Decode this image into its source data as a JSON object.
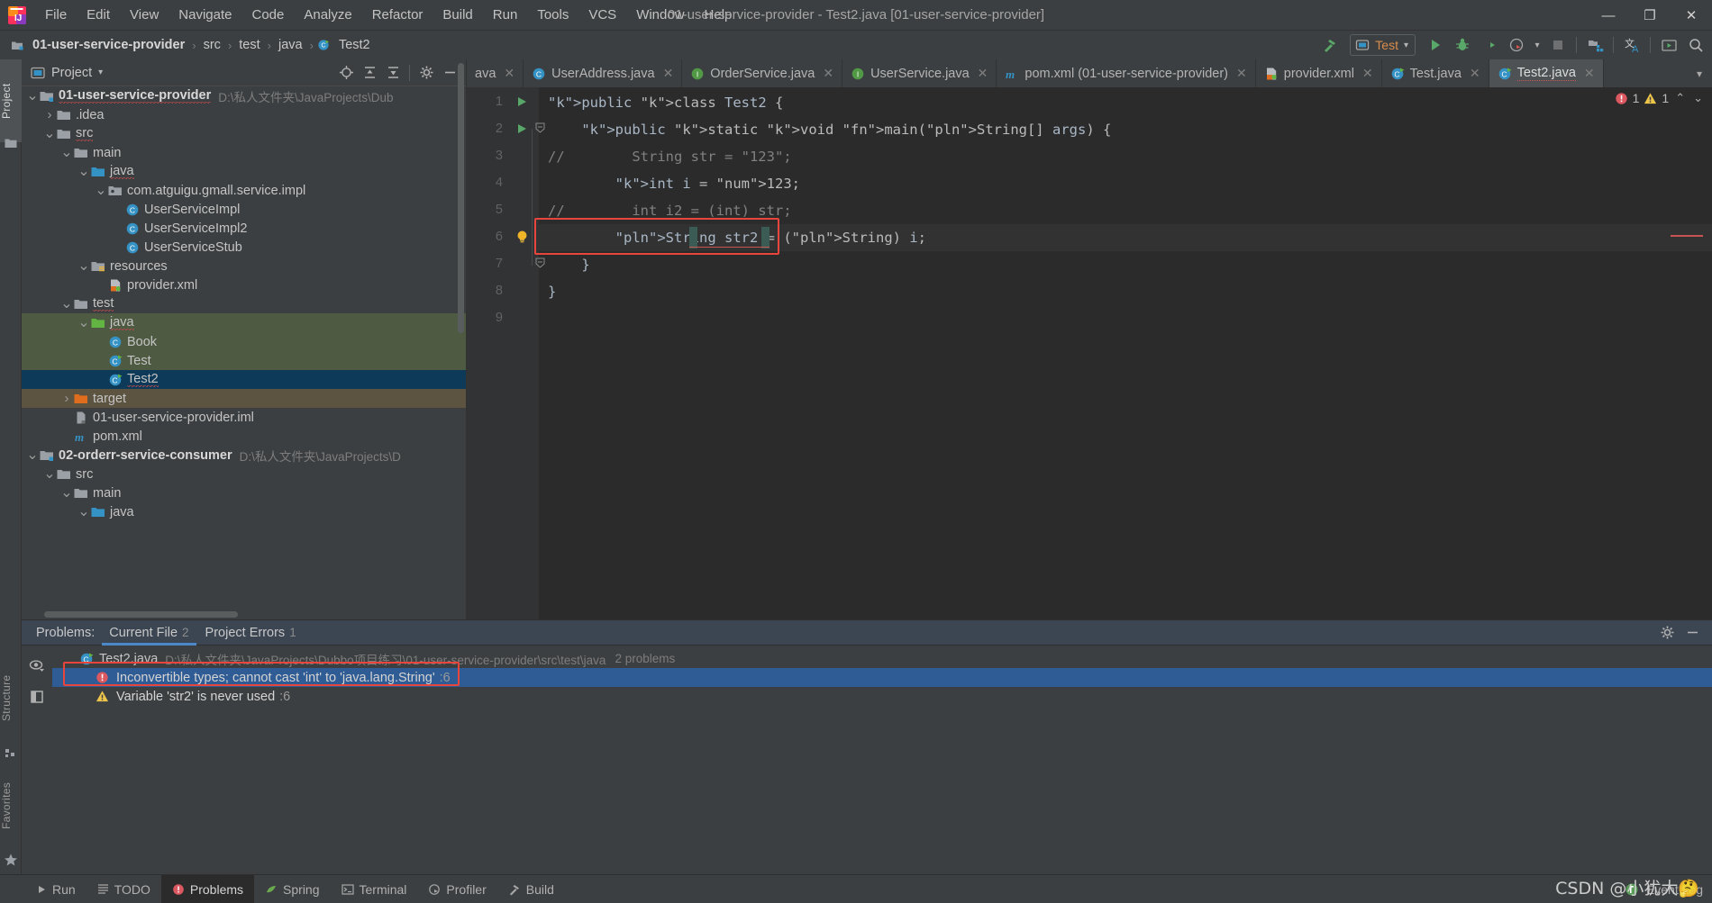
{
  "window": {
    "title": "01-user-service-provider - Test2.java [01-user-service-provider]",
    "minimize": "—",
    "maximize": "❐",
    "close": "✕"
  },
  "menubar": {
    "items": [
      "File",
      "Edit",
      "View",
      "Navigate",
      "Code",
      "Analyze",
      "Refactor",
      "Build",
      "Run",
      "Tools",
      "VCS",
      "Window",
      "Help"
    ]
  },
  "breadcrumb": {
    "items": [
      {
        "label": "01-user-service-provider",
        "bold": true,
        "icon": "module-icon"
      },
      {
        "label": "src",
        "bold": false,
        "icon": "none"
      },
      {
        "label": "test",
        "bold": false,
        "icon": "none"
      },
      {
        "label": "java",
        "bold": false,
        "icon": "none"
      },
      {
        "label": "Test2",
        "bold": false,
        "icon": "class-icon"
      }
    ],
    "separator": "›"
  },
  "toolbar": {
    "build_icon": "hammer-icon",
    "run_config": {
      "label": "Test",
      "icon": "run-config-icon",
      "chevron": "▾"
    },
    "buttons": [
      {
        "name": "run-button",
        "icon": "play-icon"
      },
      {
        "name": "debug-button",
        "icon": "bug-icon"
      },
      {
        "name": "run-with-coverage-button",
        "icon": "coverage-icon"
      },
      {
        "name": "profiler-button",
        "icon": "profiler-icon"
      },
      {
        "name": "profiler-dropdown",
        "icon": "chevron-down-icon"
      },
      {
        "name": "stop-button",
        "icon": "stop-icon"
      },
      {
        "name": "project-structure-button",
        "icon": "project-structure-icon"
      },
      {
        "name": "translate-button",
        "icon": "translate-icon"
      },
      {
        "name": "presentation-button",
        "icon": "presentation-icon"
      },
      {
        "name": "search-button",
        "icon": "search-icon"
      }
    ]
  },
  "left_strip": {
    "tabs": [
      {
        "label": "Project",
        "active": true,
        "icon": "folder-icon"
      },
      {
        "label": "Structure",
        "active": false,
        "icon": "structure-icon"
      },
      {
        "label": "Favorites",
        "active": false,
        "icon": "star-icon"
      }
    ]
  },
  "project_panel": {
    "title": "Project",
    "title_chevron": "▾",
    "tools": [
      {
        "name": "select-opened-file-button",
        "icon": "target-icon"
      },
      {
        "name": "expand-all-button",
        "icon": "expand-all-icon"
      },
      {
        "name": "collapse-all-button",
        "icon": "collapse-all-icon"
      },
      {
        "name": "settings-button",
        "icon": "gear-icon"
      },
      {
        "name": "hide-button",
        "icon": "minus-icon"
      }
    ],
    "tree": [
      {
        "depth": 0,
        "arrow": "v",
        "icon": "module-icon",
        "label": "01-user-service-provider",
        "bold": true,
        "path": "D:\\私人文件夹\\JavaProjects\\Dub",
        "state": "none",
        "squiggle": true
      },
      {
        "depth": 1,
        "arrow": ">",
        "icon": "folder-icon",
        "label": ".idea",
        "bold": false,
        "path": "",
        "state": "none",
        "squiggle": false
      },
      {
        "depth": 1,
        "arrow": "v",
        "icon": "folder-icon",
        "label": "src",
        "bold": false,
        "path": "",
        "state": "none",
        "squiggle": true
      },
      {
        "depth": 2,
        "arrow": "v",
        "icon": "folder-icon",
        "label": "main",
        "bold": false,
        "path": "",
        "state": "none",
        "squiggle": false
      },
      {
        "depth": 3,
        "arrow": "v",
        "icon": "source-folder-icon",
        "label": "java",
        "bold": false,
        "path": "",
        "state": "none",
        "squiggle": true
      },
      {
        "depth": 4,
        "arrow": "v",
        "icon": "package-icon",
        "label": "com.atguigu.gmall.service.impl",
        "bold": false,
        "path": "",
        "state": "none",
        "squiggle": false
      },
      {
        "depth": 5,
        "arrow": "",
        "icon": "class-icon",
        "label": "UserServiceImpl",
        "bold": false,
        "path": "",
        "state": "none",
        "squiggle": false
      },
      {
        "depth": 5,
        "arrow": "",
        "icon": "class-icon",
        "label": "UserServiceImpl2",
        "bold": false,
        "path": "",
        "state": "none",
        "squiggle": false
      },
      {
        "depth": 5,
        "arrow": "",
        "icon": "class-icon",
        "label": "UserServiceStub",
        "bold": false,
        "path": "",
        "state": "none",
        "squiggle": false
      },
      {
        "depth": 3,
        "arrow": "v",
        "icon": "resource-folder-icon",
        "label": "resources",
        "bold": false,
        "path": "",
        "state": "none",
        "squiggle": false
      },
      {
        "depth": 4,
        "arrow": "",
        "icon": "xml-icon",
        "label": "provider.xml",
        "bold": false,
        "path": "",
        "state": "none",
        "squiggle": false
      },
      {
        "depth": 2,
        "arrow": "v",
        "icon": "folder-icon",
        "label": "test",
        "bold": false,
        "path": "",
        "state": "none",
        "squiggle": true
      },
      {
        "depth": 3,
        "arrow": "v",
        "icon": "test-source-folder-icon",
        "label": "java",
        "bold": false,
        "path": "",
        "state": "green",
        "squiggle": true
      },
      {
        "depth": 4,
        "arrow": "",
        "icon": "class-icon",
        "label": "Book",
        "bold": false,
        "path": "",
        "state": "green",
        "squiggle": false
      },
      {
        "depth": 4,
        "arrow": "",
        "icon": "runnable-class-icon",
        "label": "Test",
        "bold": false,
        "path": "",
        "state": "green",
        "squiggle": false
      },
      {
        "depth": 4,
        "arrow": "",
        "icon": "runnable-class-icon",
        "label": "Test2",
        "bold": false,
        "path": "",
        "state": "blue",
        "squiggle": true
      },
      {
        "depth": 2,
        "arrow": ">",
        "icon": "excluded-folder-icon",
        "label": "target",
        "bold": false,
        "path": "",
        "state": "brown",
        "squiggle": false
      },
      {
        "depth": 2,
        "arrow": "",
        "icon": "iml-icon",
        "label": "01-user-service-provider.iml",
        "bold": false,
        "path": "",
        "state": "none",
        "squiggle": false
      },
      {
        "depth": 2,
        "arrow": "",
        "icon": "maven-icon",
        "label": "pom.xml",
        "bold": false,
        "path": "",
        "state": "none",
        "squiggle": false
      },
      {
        "depth": 0,
        "arrow": "v",
        "icon": "module-icon",
        "label": "02-orderr-service-consumer",
        "bold": true,
        "path": "D:\\私人文件夹\\JavaProjects\\D",
        "state": "none",
        "squiggle": false
      },
      {
        "depth": 1,
        "arrow": "v",
        "icon": "folder-icon",
        "label": "src",
        "bold": false,
        "path": "",
        "state": "none",
        "squiggle": false
      },
      {
        "depth": 2,
        "arrow": "v",
        "icon": "folder-icon",
        "label": "main",
        "bold": false,
        "path": "",
        "state": "none",
        "squiggle": false
      },
      {
        "depth": 3,
        "arrow": "v",
        "icon": "source-folder-icon",
        "label": "java",
        "bold": false,
        "path": "",
        "state": "none",
        "squiggle": false
      }
    ]
  },
  "editor": {
    "tabs": [
      {
        "label": "ava",
        "icon": "none",
        "active": false,
        "close": "✕",
        "truncated": true
      },
      {
        "label": "UserAddress.java",
        "icon": "class-icon",
        "active": false,
        "close": "✕",
        "truncated": false
      },
      {
        "label": "OrderService.java",
        "icon": "interface-icon",
        "active": false,
        "close": "✕",
        "truncated": false
      },
      {
        "label": "UserService.java",
        "icon": "interface-icon",
        "active": false,
        "close": "✕",
        "truncated": false
      },
      {
        "label": "pom.xml (01-user-service-provider)",
        "icon": "maven-icon",
        "active": false,
        "close": "✕",
        "truncated": false
      },
      {
        "label": "provider.xml",
        "icon": "xml-icon",
        "active": false,
        "close": "✕",
        "truncated": false
      },
      {
        "label": "Test.java",
        "icon": "runnable-class-icon",
        "active": false,
        "close": "✕",
        "truncated": false
      },
      {
        "label": "Test2.java",
        "icon": "runnable-class-icon",
        "active": true,
        "close": "✕",
        "truncated": false
      }
    ],
    "tabs_more": "▾",
    "inspection": {
      "error_count": "1",
      "warning_count": "1",
      "up": "⌃",
      "down": "⌄"
    },
    "lines": [
      {
        "no": "1",
        "gutter": "run",
        "fold": "",
        "text": "public class Test2 {"
      },
      {
        "no": "2",
        "gutter": "run",
        "fold": "minus",
        "text": "    public static void main(String[] args) {"
      },
      {
        "no": "3",
        "gutter": "",
        "fold": "",
        "text": "//        String str = \"123\";"
      },
      {
        "no": "4",
        "gutter": "",
        "fold": "",
        "text": "        int i = 123;"
      },
      {
        "no": "5",
        "gutter": "",
        "fold": "",
        "text": "//        int i2 = (int) str;"
      },
      {
        "no": "6",
        "gutter": "bulb",
        "fold": "",
        "text": "        String str2 = (String) i;"
      },
      {
        "no": "7",
        "gutter": "",
        "fold": "minus",
        "text": "    }"
      },
      {
        "no": "8",
        "gutter": "",
        "fold": "",
        "text": "}"
      },
      {
        "no": "9",
        "gutter": "",
        "fold": "",
        "text": ""
      }
    ]
  },
  "problems": {
    "label": "Problems:",
    "tabs": [
      {
        "label": "Current File",
        "count": "2",
        "active": true
      },
      {
        "label": "Project Errors",
        "count": "1",
        "active": false
      }
    ],
    "tools": [
      {
        "name": "problems-settings-button",
        "icon": "gear-icon"
      },
      {
        "name": "problems-hide-button",
        "icon": "minus-icon"
      }
    ],
    "gutter_buttons": [
      {
        "name": "inspection-preview-button",
        "icon": "eye-icon"
      },
      {
        "name": "open-editor-preview-button",
        "icon": "preview-icon"
      }
    ],
    "file": {
      "name": "Test2.java",
      "path": "D:\\私人文件夹\\JavaProjects\\Dubbo项目练习\\01-user-service-provider\\src\\test\\java",
      "count": "2 problems"
    },
    "items": [
      {
        "severity": "error",
        "message": "Inconvertible types; cannot cast 'int' to 'java.lang.String'",
        "line": ":6",
        "selected": true
      },
      {
        "severity": "warning",
        "message": "Variable 'str2' is never used",
        "line": ":6",
        "selected": false
      }
    ]
  },
  "statusbar": {
    "items": [
      {
        "label": "Run",
        "icon": "play-icon",
        "active": false
      },
      {
        "label": "TODO",
        "icon": "todo-icon",
        "active": false
      },
      {
        "label": "Problems",
        "icon": "error-icon",
        "active": true
      },
      {
        "label": "Spring",
        "icon": "spring-icon",
        "active": false
      },
      {
        "label": "Terminal",
        "icon": "terminal-icon",
        "active": false
      },
      {
        "label": "Profiler",
        "icon": "profiler-icon",
        "active": false
      },
      {
        "label": "Build",
        "icon": "hammer-icon",
        "active": false
      }
    ],
    "event_log": {
      "label": "Event Log",
      "icon": "event-log-icon"
    }
  },
  "watermark": "CSDN @小犹大🤔",
  "colors": {
    "accent_blue": "#2f5c94",
    "error_red": "#e8453c",
    "warning_yellow": "#e8b339",
    "tab_underline": "#4a88c7",
    "selection_blue": "#0d3a58",
    "selection_green": "#4e5b42",
    "selection_brown": "#5c5340"
  }
}
